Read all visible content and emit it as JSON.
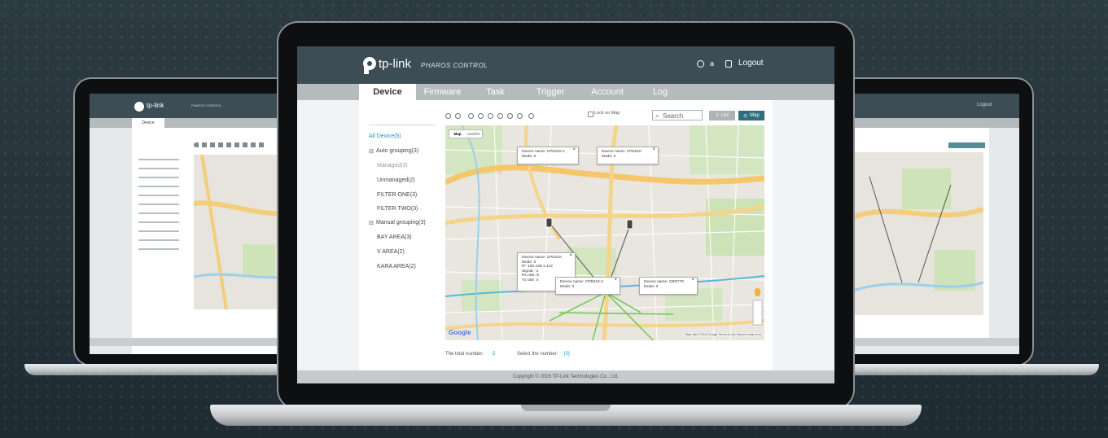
{
  "brand": {
    "logo_text": "tp-link",
    "product": "PHAROS CONTROL"
  },
  "header": {
    "user_label": "a",
    "logout_label": "Logout"
  },
  "tabs": [
    "Device",
    "Firmware",
    "Task",
    "Trigger",
    "Account",
    "Log"
  ],
  "sidebar": {
    "items": [
      {
        "label": "All Device(5)",
        "accent": true
      },
      {
        "label": "Auto grouping(3)",
        "tree": true
      },
      {
        "label": "Managed(3)",
        "muted": true
      },
      {
        "label": "Unmanaged(2)"
      },
      {
        "label": "FILTER ONE(3)"
      },
      {
        "label": "FILTER TWO(3)"
      },
      {
        "label": "Manual grouping(3)",
        "tree": true
      },
      {
        "label": "BAY AREA(3)"
      },
      {
        "label": "V AREA(2)"
      },
      {
        "label": "KARA AREA(2)"
      }
    ]
  },
  "toolbar": {
    "lock_label": "Lock on Map",
    "search_placeholder": "Search",
    "list_label": "List",
    "map_label": "Map"
  },
  "map": {
    "type_buttons": [
      "Map",
      "Satellite"
    ],
    "attribution_left": "Google",
    "attribution_right": "Map data ©2016 Google   Terms of Use   Report a map error",
    "popups": [
      {
        "lines": [
          "Device name: CPE210-1",
          "Mode: 0"
        ]
      },
      {
        "lines": [
          "Device name: CPE510",
          "Mode: 0"
        ]
      },
      {
        "lines": [
          "Device name: CPE210",
          "Mode: 0",
          "IP: 192.168.1.122",
          "Signal: -1",
          "Rx rate: 8",
          "Tx rate: 4"
        ]
      },
      {
        "lines": [
          "Device name: CPE510-2",
          "Mode: 0"
        ]
      },
      {
        "lines": [
          "Device name: CBD770",
          "Mode: 0"
        ]
      }
    ]
  },
  "footer": {
    "total_label": "The total number:",
    "total_value": "5",
    "select_label": "Select the number:",
    "select_value": "[0]",
    "copyright": "Copyright © 2016 TP-Link Technologies Co., Ltd."
  },
  "colors": {
    "header": "#3d4d55",
    "nav": "#b5babd",
    "accent": "#1f8fc4",
    "map_btn": "#2f6f7d",
    "link_line": "#6ec94e"
  }
}
